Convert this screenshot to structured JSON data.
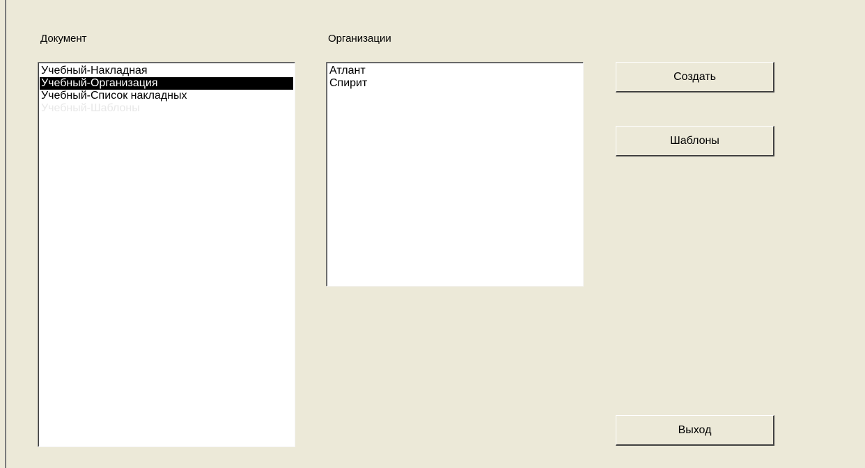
{
  "labels": {
    "document": "Документ",
    "organizations": "Организации"
  },
  "documents": {
    "items": [
      {
        "label": "Учебный-Накладная"
      },
      {
        "label": "Учебный-Организация"
      },
      {
        "label": "Учебный-Список накладных"
      },
      {
        "label": "Учебный-Шаблоны"
      }
    ],
    "selected_index": 1
  },
  "organizations": {
    "items": [
      {
        "label": "Атлант"
      },
      {
        "label": "Спирит"
      }
    ]
  },
  "buttons": {
    "create": "Создать",
    "templates": "Шаблоны",
    "exit": "Выход"
  },
  "colors": {
    "background": "#ece9d8",
    "selection": "#000000",
    "list_background": "#ffffff"
  }
}
